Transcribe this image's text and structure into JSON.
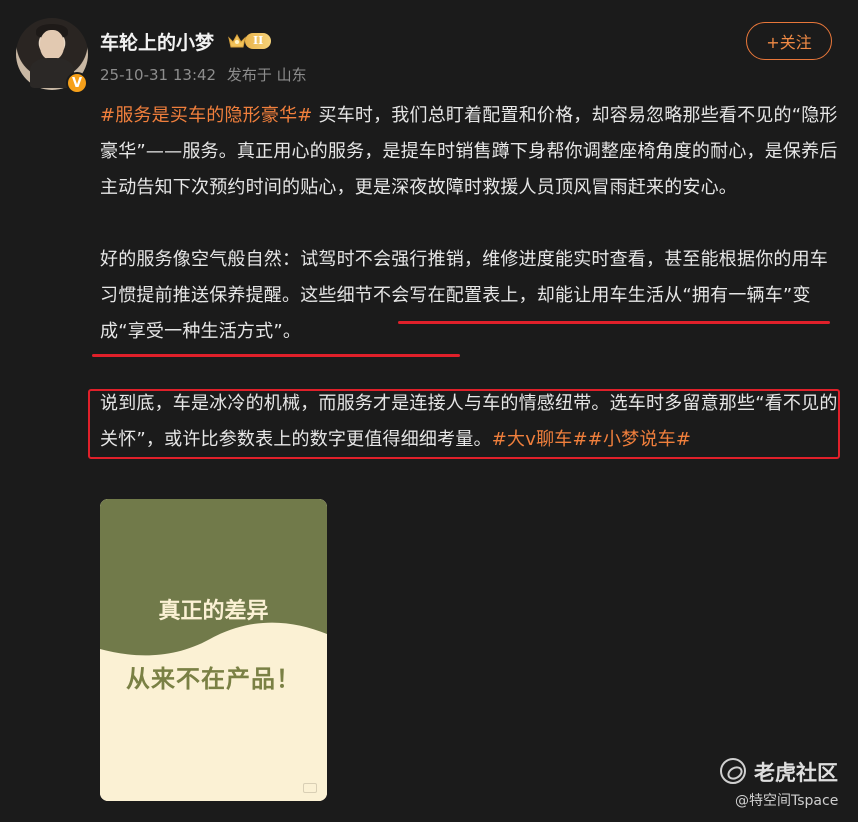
{
  "header": {
    "username": "车轮上的小梦",
    "level_badge": "II",
    "verified_mark": "V",
    "timestamp": "25-10-31 13:42",
    "posted_from": "发布于 山东",
    "follow_label": "+关注"
  },
  "post": {
    "p1_tag": "#服务是买车的隐形豪华#",
    "p1_text": " 买车时，我们总盯着配置和价格，却容易忽略那些看不见的“隐形豪华”——服务。真正用心的服务，是提车时销售蹲下身帮你调整座椅角度的耐心，是保养后主动告知下次预约时间的贴心，更是深夜故障时救援人员顶风冒雨赶来的安心。",
    "p2_text": "好的服务像空气般自然：试驾时不会强行推销，维修进度能实时查看，甚至能根据你的用车习惯提前推送保养提醒。",
    "p2_highlight": "这些细节不会写在配置表上，却能让用车生活从“拥有一辆车”变成“享受一种生活方式”。",
    "p3_text": "说到底，车是冰冷的机械，而服务才是连接人与车的情感纽带。选车时多留意那些“看不见的关怀”，或许比参数表上的数字更值得细细考量。",
    "p3_tag1": "#大v聊车#",
    "p3_tag2": "#小梦说车#"
  },
  "image_card": {
    "line1": "真正的差异",
    "line2": "从来不在产品！"
  },
  "watermark": {
    "name": "老虎社区",
    "sub": "@特空间Tspace"
  },
  "colors": {
    "background": "#1b1b1b",
    "tag": "#f07f3c",
    "follow_border": "#e8773a",
    "annotation_red": "#e0202a",
    "card_green": "#717a4a",
    "card_cream": "#fbf1d4"
  }
}
